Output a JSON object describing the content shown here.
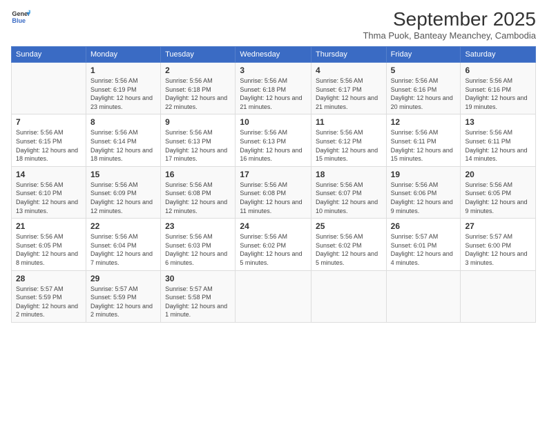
{
  "logo": {
    "line1": "General",
    "line2": "Blue"
  },
  "title": "September 2025",
  "subtitle": "Thma Puok, Banteay Meanchey, Cambodia",
  "days_of_week": [
    "Sunday",
    "Monday",
    "Tuesday",
    "Wednesday",
    "Thursday",
    "Friday",
    "Saturday"
  ],
  "weeks": [
    [
      {
        "day": "",
        "sunrise": "",
        "sunset": "",
        "daylight": ""
      },
      {
        "day": "1",
        "sunrise": "Sunrise: 5:56 AM",
        "sunset": "Sunset: 6:19 PM",
        "daylight": "Daylight: 12 hours and 23 minutes."
      },
      {
        "day": "2",
        "sunrise": "Sunrise: 5:56 AM",
        "sunset": "Sunset: 6:18 PM",
        "daylight": "Daylight: 12 hours and 22 minutes."
      },
      {
        "day": "3",
        "sunrise": "Sunrise: 5:56 AM",
        "sunset": "Sunset: 6:18 PM",
        "daylight": "Daylight: 12 hours and 21 minutes."
      },
      {
        "day": "4",
        "sunrise": "Sunrise: 5:56 AM",
        "sunset": "Sunset: 6:17 PM",
        "daylight": "Daylight: 12 hours and 21 minutes."
      },
      {
        "day": "5",
        "sunrise": "Sunrise: 5:56 AM",
        "sunset": "Sunset: 6:16 PM",
        "daylight": "Daylight: 12 hours and 20 minutes."
      },
      {
        "day": "6",
        "sunrise": "Sunrise: 5:56 AM",
        "sunset": "Sunset: 6:16 PM",
        "daylight": "Daylight: 12 hours and 19 minutes."
      }
    ],
    [
      {
        "day": "7",
        "sunrise": "Sunrise: 5:56 AM",
        "sunset": "Sunset: 6:15 PM",
        "daylight": "Daylight: 12 hours and 18 minutes."
      },
      {
        "day": "8",
        "sunrise": "Sunrise: 5:56 AM",
        "sunset": "Sunset: 6:14 PM",
        "daylight": "Daylight: 12 hours and 18 minutes."
      },
      {
        "day": "9",
        "sunrise": "Sunrise: 5:56 AM",
        "sunset": "Sunset: 6:13 PM",
        "daylight": "Daylight: 12 hours and 17 minutes."
      },
      {
        "day": "10",
        "sunrise": "Sunrise: 5:56 AM",
        "sunset": "Sunset: 6:13 PM",
        "daylight": "Daylight: 12 hours and 16 minutes."
      },
      {
        "day": "11",
        "sunrise": "Sunrise: 5:56 AM",
        "sunset": "Sunset: 6:12 PM",
        "daylight": "Daylight: 12 hours and 15 minutes."
      },
      {
        "day": "12",
        "sunrise": "Sunrise: 5:56 AM",
        "sunset": "Sunset: 6:11 PM",
        "daylight": "Daylight: 12 hours and 15 minutes."
      },
      {
        "day": "13",
        "sunrise": "Sunrise: 5:56 AM",
        "sunset": "Sunset: 6:11 PM",
        "daylight": "Daylight: 12 hours and 14 minutes."
      }
    ],
    [
      {
        "day": "14",
        "sunrise": "Sunrise: 5:56 AM",
        "sunset": "Sunset: 6:10 PM",
        "daylight": "Daylight: 12 hours and 13 minutes."
      },
      {
        "day": "15",
        "sunrise": "Sunrise: 5:56 AM",
        "sunset": "Sunset: 6:09 PM",
        "daylight": "Daylight: 12 hours and 12 minutes."
      },
      {
        "day": "16",
        "sunrise": "Sunrise: 5:56 AM",
        "sunset": "Sunset: 6:08 PM",
        "daylight": "Daylight: 12 hours and 12 minutes."
      },
      {
        "day": "17",
        "sunrise": "Sunrise: 5:56 AM",
        "sunset": "Sunset: 6:08 PM",
        "daylight": "Daylight: 12 hours and 11 minutes."
      },
      {
        "day": "18",
        "sunrise": "Sunrise: 5:56 AM",
        "sunset": "Sunset: 6:07 PM",
        "daylight": "Daylight: 12 hours and 10 minutes."
      },
      {
        "day": "19",
        "sunrise": "Sunrise: 5:56 AM",
        "sunset": "Sunset: 6:06 PM",
        "daylight": "Daylight: 12 hours and 9 minutes."
      },
      {
        "day": "20",
        "sunrise": "Sunrise: 5:56 AM",
        "sunset": "Sunset: 6:05 PM",
        "daylight": "Daylight: 12 hours and 9 minutes."
      }
    ],
    [
      {
        "day": "21",
        "sunrise": "Sunrise: 5:56 AM",
        "sunset": "Sunset: 6:05 PM",
        "daylight": "Daylight: 12 hours and 8 minutes."
      },
      {
        "day": "22",
        "sunrise": "Sunrise: 5:56 AM",
        "sunset": "Sunset: 6:04 PM",
        "daylight": "Daylight: 12 hours and 7 minutes."
      },
      {
        "day": "23",
        "sunrise": "Sunrise: 5:56 AM",
        "sunset": "Sunset: 6:03 PM",
        "daylight": "Daylight: 12 hours and 6 minutes."
      },
      {
        "day": "24",
        "sunrise": "Sunrise: 5:56 AM",
        "sunset": "Sunset: 6:02 PM",
        "daylight": "Daylight: 12 hours and 5 minutes."
      },
      {
        "day": "25",
        "sunrise": "Sunrise: 5:56 AM",
        "sunset": "Sunset: 6:02 PM",
        "daylight": "Daylight: 12 hours and 5 minutes."
      },
      {
        "day": "26",
        "sunrise": "Sunrise: 5:57 AM",
        "sunset": "Sunset: 6:01 PM",
        "daylight": "Daylight: 12 hours and 4 minutes."
      },
      {
        "day": "27",
        "sunrise": "Sunrise: 5:57 AM",
        "sunset": "Sunset: 6:00 PM",
        "daylight": "Daylight: 12 hours and 3 minutes."
      }
    ],
    [
      {
        "day": "28",
        "sunrise": "Sunrise: 5:57 AM",
        "sunset": "Sunset: 5:59 PM",
        "daylight": "Daylight: 12 hours and 2 minutes."
      },
      {
        "day": "29",
        "sunrise": "Sunrise: 5:57 AM",
        "sunset": "Sunset: 5:59 PM",
        "daylight": "Daylight: 12 hours and 2 minutes."
      },
      {
        "day": "30",
        "sunrise": "Sunrise: 5:57 AM",
        "sunset": "Sunset: 5:58 PM",
        "daylight": "Daylight: 12 hours and 1 minute."
      },
      {
        "day": "",
        "sunrise": "",
        "sunset": "",
        "daylight": ""
      },
      {
        "day": "",
        "sunrise": "",
        "sunset": "",
        "daylight": ""
      },
      {
        "day": "",
        "sunrise": "",
        "sunset": "",
        "daylight": ""
      },
      {
        "day": "",
        "sunrise": "",
        "sunset": "",
        "daylight": ""
      }
    ]
  ]
}
